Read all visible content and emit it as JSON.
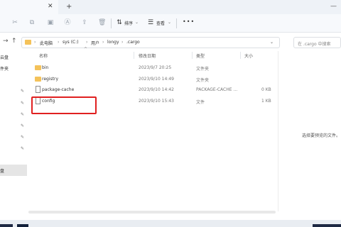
{
  "toolbar": {
    "sort_label": "排序",
    "view_label": "查看",
    "more_label": "•••"
  },
  "address": {
    "crumbs": [
      "此电脑",
      "sys (C:)",
      "用户",
      "longy",
      ".cargo"
    ],
    "search_placeholder": "在 .cargo 中搜索"
  },
  "sidebar": {
    "items": [
      "云盘",
      "件夹"
    ],
    "selected_label": "盘"
  },
  "columns": {
    "name": "名称",
    "modified": "修改日期",
    "type": "类型",
    "size": "大小"
  },
  "files": [
    {
      "name": "bin",
      "modified": "2023/9/7 20:25",
      "type": "文件夹",
      "size": "",
      "icon": "folder-icon"
    },
    {
      "name": "registry",
      "modified": "2023/9/10 14:49",
      "type": "文件夹",
      "size": "",
      "icon": "folder-icon"
    },
    {
      "name": "package-cache",
      "modified": "2023/9/10 14:42",
      "type": "PACKAGE-CACHE ...",
      "size": "0 KB",
      "icon": "file-icon"
    },
    {
      "name": "config",
      "modified": "2023/9/10 15:43",
      "type": "文件",
      "size": "1 KB",
      "icon": "file-icon"
    }
  ],
  "preview": {
    "message": "选择要预览的文件。"
  },
  "colors": {
    "folder": "#f4c25a",
    "highlight": "#e02020",
    "accent": "#1f2a44"
  }
}
